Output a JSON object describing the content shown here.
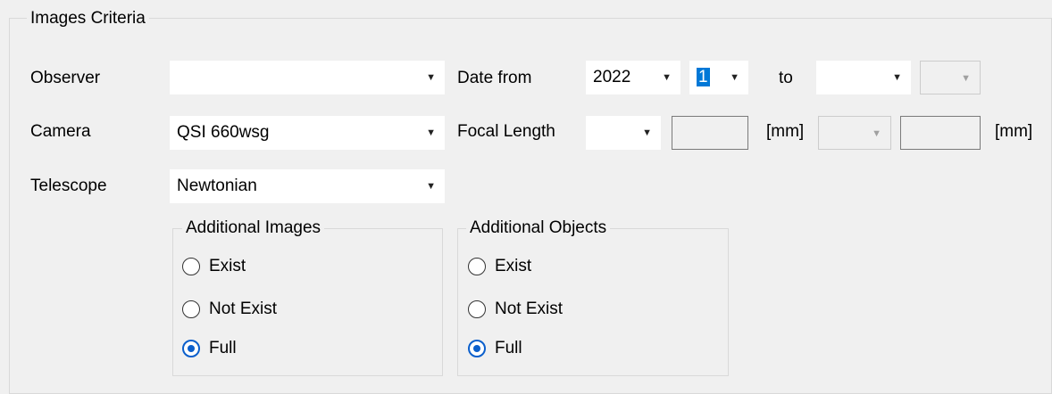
{
  "criteria": {
    "title": "Images Criteria",
    "observer": {
      "label": "Observer",
      "value": ""
    },
    "camera": {
      "label": "Camera",
      "value": "QSI 660wsg"
    },
    "telescope": {
      "label": "Telescope",
      "value": "Newtonian"
    },
    "date": {
      "label": "Date from",
      "year_from": "2022",
      "month_from": "1",
      "to_label": "to",
      "year_to": "",
      "month_to": ""
    },
    "focal": {
      "label": "Focal Length",
      "operator_from": "",
      "value_from": "",
      "unit_from": "[mm]",
      "operator_to": "",
      "value_to": "",
      "unit_to": "[mm]"
    },
    "additional_images": {
      "title": "Additional Images",
      "options": [
        "Exist",
        "Not Exist",
        "Full"
      ],
      "selected": "Full"
    },
    "additional_objects": {
      "title": "Additional Objects",
      "options": [
        "Exist",
        "Not Exist",
        "Full"
      ],
      "selected": "Full"
    }
  },
  "icons": {
    "dropdown": "chevron-down-icon",
    "radio": "radio-button-icon"
  }
}
